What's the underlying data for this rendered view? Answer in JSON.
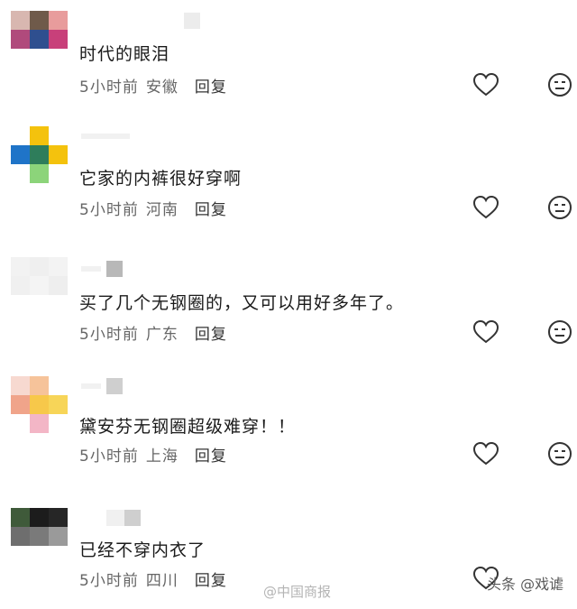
{
  "comments": [
    {
      "text": "时代的眼泪",
      "time": "5小时前",
      "location": "安徽",
      "reply_label": "回复"
    },
    {
      "text": "它家的内裤很好穿啊",
      "time": "5小时前",
      "location": "河南",
      "reply_label": "回复"
    },
    {
      "text": "买了几个无钢圈的，又可以用好多年了。",
      "time": "5小时前",
      "location": "广东",
      "reply_label": "回复"
    },
    {
      "text": "黛安芬无钢圈超级难穿！！",
      "time": "5小时前",
      "location": "上海",
      "reply_label": "回复"
    },
    {
      "text": "已经不穿内衣了",
      "time": "5小时前",
      "location": "四川",
      "reply_label": "回复"
    }
  ],
  "icons": {
    "like": "heart-icon",
    "reaction": "neutral-face-icon"
  },
  "watermarks": {
    "weibo": "@中国商报",
    "toutiao": "头条 @戏谑"
  }
}
